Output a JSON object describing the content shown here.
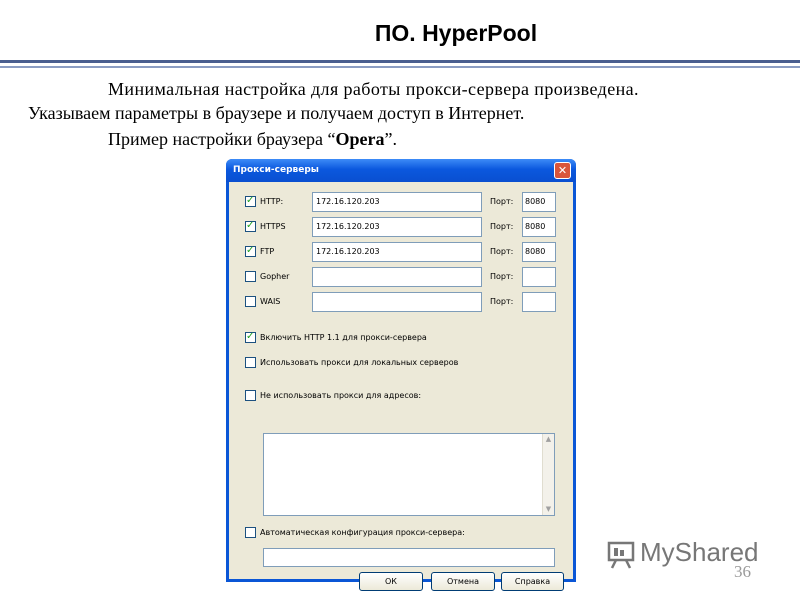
{
  "slide": {
    "title": "ПО. HyperPool",
    "line1": "Минимальная настройка для работы прокси-сервера произведена.",
    "line2": "Указываем параметры в браузере и получаем доступ в Интернет.",
    "line3_prefix": "Пример настройки браузера “",
    "line3_bold": "Opera",
    "line3_suffix": "”.",
    "page_number": "36",
    "watermark": "MyShared"
  },
  "dialog": {
    "title": "Прокси-серверы",
    "close": "✕",
    "protocols": [
      {
        "label": "HTTP:",
        "checked": true,
        "address": "172.16.120.203",
        "port_label": "Порт:",
        "port": "8080"
      },
      {
        "label": "HTTPS",
        "checked": true,
        "address": "172.16.120.203",
        "port_label": "Порт:",
        "port": "8080"
      },
      {
        "label": "FTP",
        "checked": true,
        "address": "172.16.120.203",
        "port_label": "Порт:",
        "port": "8080"
      },
      {
        "label": "Gopher",
        "checked": false,
        "address": "",
        "port_label": "Порт:",
        "port": ""
      },
      {
        "label": "WAIS",
        "checked": false,
        "address": "",
        "port_label": "Порт:",
        "port": ""
      }
    ],
    "options": {
      "http11": {
        "label": "Включить HTTP 1.1 для прокси-сервера",
        "checked": true
      },
      "local": {
        "label": "Использовать прокси для локальных серверов",
        "checked": false
      },
      "exclude": {
        "label": "Не использовать прокси для адресов:",
        "checked": false
      },
      "autoconfig": {
        "label": "Автоматическая конфигурация прокси-сервера:",
        "checked": false
      }
    },
    "buttons": {
      "ok": "ОК",
      "cancel": "Отмена",
      "help": "Справка"
    }
  },
  "colors": {
    "titlebar": "#0b58de",
    "dialog_bg": "#ece9d8",
    "checkmark": "#21a121"
  }
}
